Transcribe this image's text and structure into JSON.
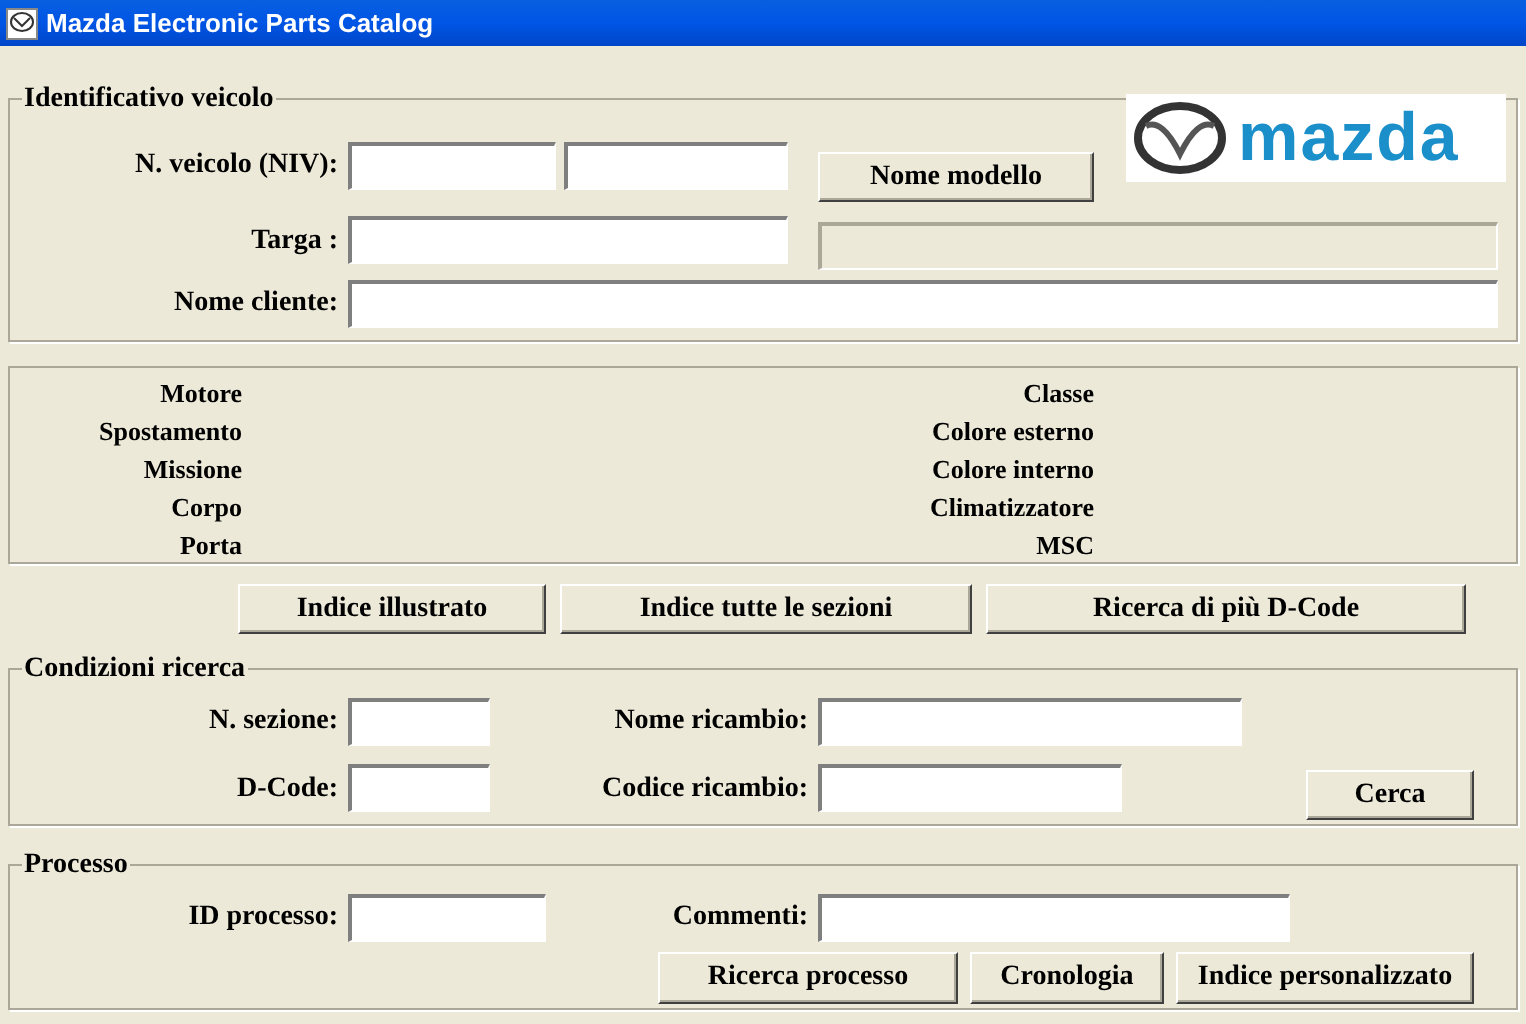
{
  "window": {
    "title": "Mazda Electronic Parts Catalog"
  },
  "vehicle_id": {
    "legend": "Identificativo veicolo",
    "logo_text": "mazda",
    "vin_label": "N. veicolo (NIV):",
    "model_button": "Nome modello",
    "plate_label": "Targa :",
    "customer_label": "Nome cliente:"
  },
  "vehicle_info": {
    "left": [
      "Motore",
      "Spostamento",
      "Missione",
      "Corpo",
      "Porta"
    ],
    "right": [
      "Classe",
      "Colore esterno",
      "Colore interno",
      "Climatizzatore",
      "MSC"
    ]
  },
  "index_buttons": [
    "Indice illustrato",
    "Indice tutte le sezioni",
    "Ricerca di più D-Code"
  ],
  "search": {
    "legend": "Condizioni ricerca",
    "section_label": "N. sezione:",
    "part_name_label": "Nome ricambio:",
    "dcode_label": "D-Code:",
    "part_code_label": "Codice ricambio:",
    "search_button": "Cerca"
  },
  "process": {
    "legend": "Processo",
    "id_label": "ID processo:",
    "comments_label": "Commenti:",
    "buttons": [
      "Ricerca processo",
      "Cronologia",
      "Indice personalizzato"
    ]
  }
}
